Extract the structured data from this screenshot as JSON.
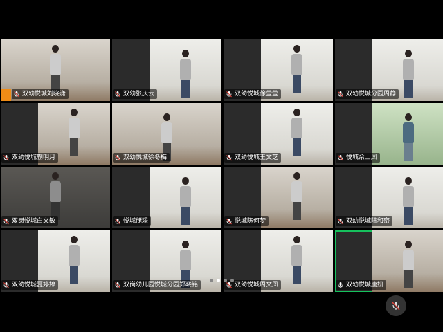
{
  "participants": [
    {
      "name": "双幼悦城刘晓潇",
      "muted": true,
      "host_badge": true,
      "scene": "room"
    },
    {
      "name": "双幼张庆云",
      "muted": true,
      "scene": "white"
    },
    {
      "name": "双幼悦城徐莹莹",
      "muted": true,
      "scene": "white"
    },
    {
      "name": "双幼悦城分园周静",
      "muted": true,
      "scene": "white"
    },
    {
      "name": "双幼悦城蒯明月",
      "muted": true,
      "scene": "room"
    },
    {
      "name": "双幼悦城徐冬梅",
      "muted": true,
      "scene": "room"
    },
    {
      "name": "双幼悦城王文芝",
      "muted": true,
      "scene": "white"
    },
    {
      "name": "悦城佘士凤",
      "muted": true,
      "scene": "green"
    },
    {
      "name": "双岗悦城白义敏",
      "muted": true,
      "scene": "dark"
    },
    {
      "name": "悦城储璟",
      "muted": true,
      "scene": "white"
    },
    {
      "name": "悦城陈何梦",
      "muted": true,
      "scene": "room"
    },
    {
      "name": "双幼悦城陆和密",
      "muted": true,
      "scene": "white"
    },
    {
      "name": "双幼悦城夏婷婷",
      "muted": true,
      "scene": "white"
    },
    {
      "name": "双岗幼儿园悦城分园郑晓铭",
      "muted": true,
      "scene": "white"
    },
    {
      "name": "双幼悦城周文凤",
      "muted": true,
      "scene": "white"
    },
    {
      "name": "双幼悦城唐妍",
      "muted": false,
      "active": true,
      "scene": "room"
    }
  ],
  "pager": {
    "count": 4,
    "active_index": 1
  },
  "colors": {
    "active_border": "#16c15d",
    "badge": "#f08c16",
    "tile_bg": "#2b2b2b"
  },
  "icons": {
    "muted": "mic-off-icon",
    "unmuted": "mic-icon",
    "control": "mic-off-icon"
  }
}
